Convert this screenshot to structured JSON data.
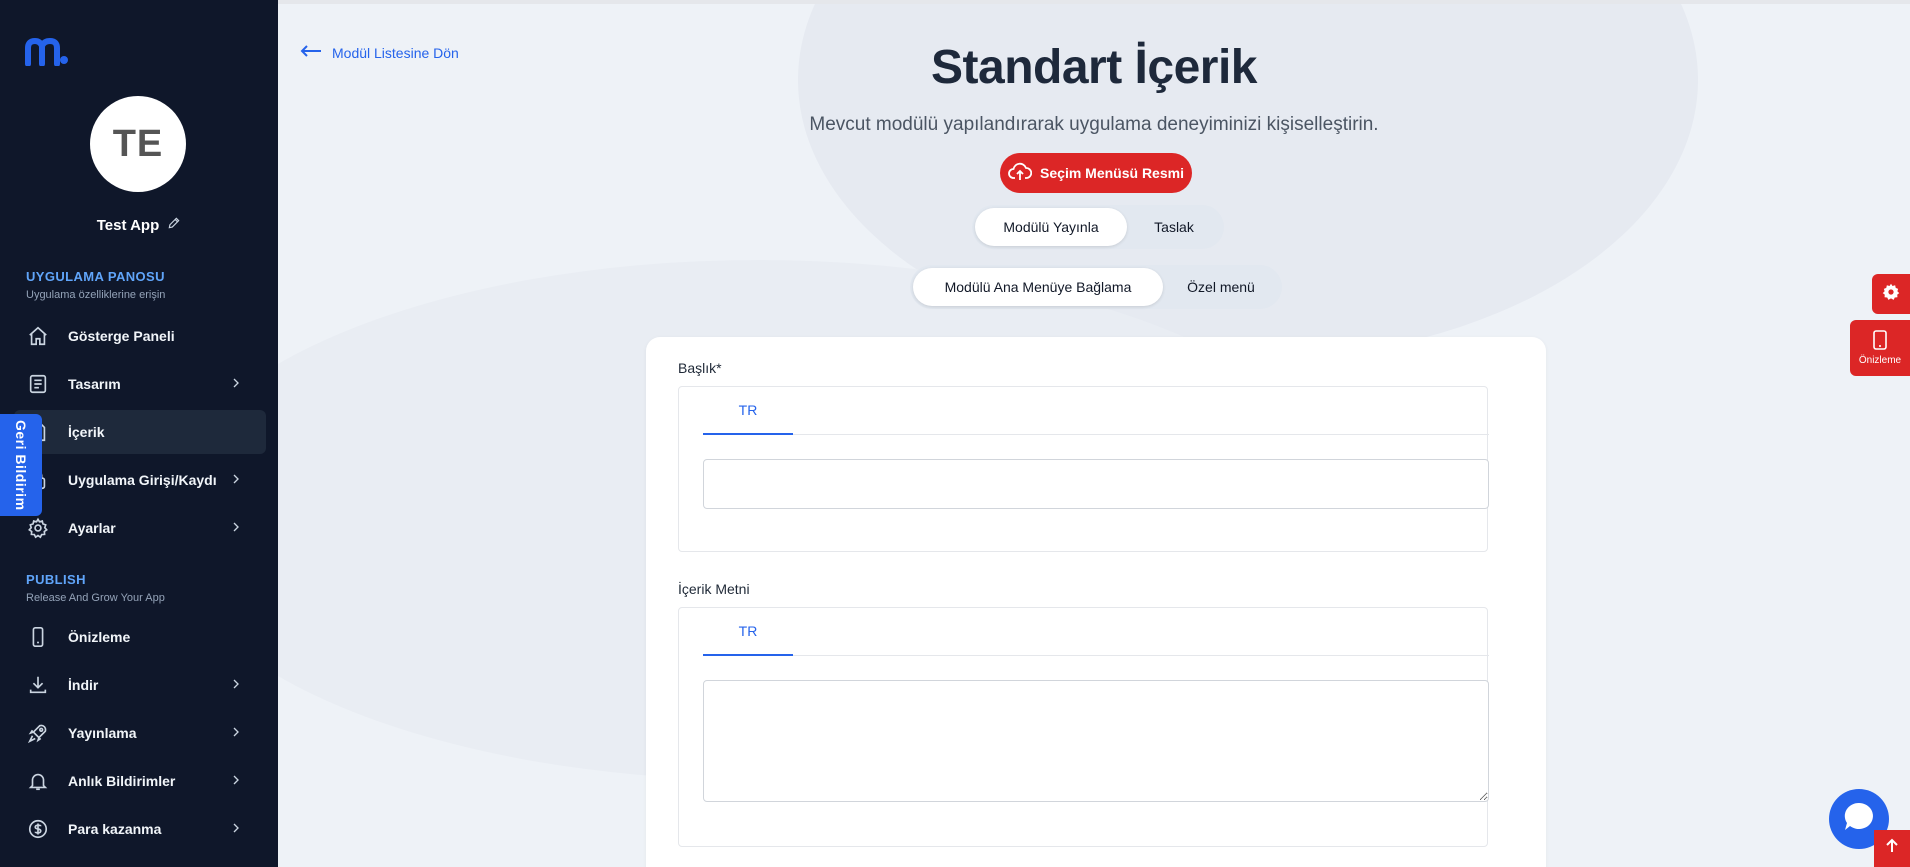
{
  "sidebar": {
    "logo": "m.",
    "avatar_initials": "TE",
    "app_name": "Test App",
    "section1": {
      "title": "UYGULAMA PANOSU",
      "subtitle": "Uygulama özelliklerine erişin"
    },
    "items1": [
      {
        "label": "Gösterge Paneli",
        "icon": "home-icon",
        "chevron": false
      },
      {
        "label": "Tasarım",
        "icon": "design-icon",
        "chevron": true
      },
      {
        "label": "İçerik",
        "icon": "content-icon",
        "chevron": false,
        "active": true
      },
      {
        "label": "Uygulama Girişi/Kaydı",
        "icon": "login-icon",
        "chevron": true
      },
      {
        "label": "Ayarlar",
        "icon": "gear-icon",
        "chevron": true
      }
    ],
    "section2": {
      "title": "PUBLISH",
      "subtitle": "Release And Grow Your App"
    },
    "items2": [
      {
        "label": "Önizleme",
        "icon": "phone-icon",
        "chevron": false
      },
      {
        "label": "İndir",
        "icon": "download-icon",
        "chevron": true
      },
      {
        "label": "Yayınlama",
        "icon": "rocket-icon",
        "chevron": true
      },
      {
        "label": "Anlık Bildirimler",
        "icon": "bell-icon",
        "chevron": true
      },
      {
        "label": "Para kazanma",
        "icon": "dollar-icon",
        "chevron": true
      }
    ]
  },
  "feedback_label": "Geri Bildirim",
  "main": {
    "back_link": "Modül Listesine Dön",
    "title": "Standart İçerik",
    "subtitle": "Mevcut modülü yapılandırarak uygulama deneyiminizi kişiselleştirin.",
    "image_button": "Seçim Menüsü Resmi",
    "publish_toggle": {
      "options": [
        "Modülü Yayınla",
        "Taslak"
      ],
      "selected": "Modülü Yayınla"
    },
    "menu_toggle": {
      "options": [
        "Modülü Ana Menüye Bağlama",
        "Özel menü"
      ],
      "selected": "Modülü Ana Menüye Bağlama"
    },
    "form": {
      "title_label": "Başlık*",
      "title_tab": "TR",
      "title_value": "",
      "content_label": "İçerik Metni",
      "content_tab": "TR",
      "content_value": ""
    }
  },
  "floating": {
    "preview_label": "Önizleme"
  },
  "colors": {
    "sidebar_bg": "#0f172a",
    "accent_blue": "#2563eb",
    "accent_red": "#dc2626",
    "section_title": "#60a5fa"
  }
}
